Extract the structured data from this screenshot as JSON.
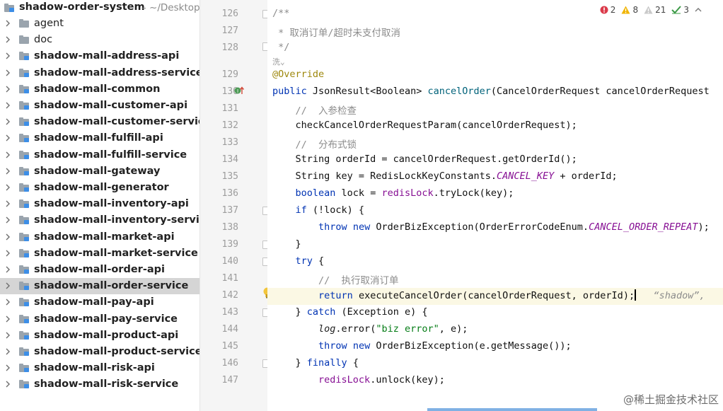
{
  "project": {
    "name": "shadow-order-system",
    "path": "~/Desktop",
    "items": [
      {
        "label": "agent",
        "type": "folder"
      },
      {
        "label": "doc",
        "type": "folder"
      },
      {
        "label": "shadow-mall-address-api",
        "type": "module"
      },
      {
        "label": "shadow-mall-address-service",
        "type": "module"
      },
      {
        "label": "shadow-mall-common",
        "type": "module"
      },
      {
        "label": "shadow-mall-customer-api",
        "type": "module"
      },
      {
        "label": "shadow-mall-customer-service",
        "type": "module"
      },
      {
        "label": "shadow-mall-fulfill-api",
        "type": "module"
      },
      {
        "label": "shadow-mall-fulfill-service",
        "type": "module"
      },
      {
        "label": "shadow-mall-gateway",
        "type": "module"
      },
      {
        "label": "shadow-mall-generator",
        "type": "module"
      },
      {
        "label": "shadow-mall-inventory-api",
        "type": "module"
      },
      {
        "label": "shadow-mall-inventory-service",
        "type": "module"
      },
      {
        "label": "shadow-mall-market-api",
        "type": "module"
      },
      {
        "label": "shadow-mall-market-service",
        "type": "module"
      },
      {
        "label": "shadow-mall-order-api",
        "type": "module"
      },
      {
        "label": "shadow-mall-order-service",
        "type": "module",
        "selected": true
      },
      {
        "label": "shadow-mall-pay-api",
        "type": "module"
      },
      {
        "label": "shadow-mall-pay-service",
        "type": "module"
      },
      {
        "label": "shadow-mall-product-api",
        "type": "module"
      },
      {
        "label": "shadow-mall-product-service",
        "type": "module"
      },
      {
        "label": "shadow-mall-risk-api",
        "type": "module"
      },
      {
        "label": "shadow-mall-risk-service",
        "type": "module"
      }
    ]
  },
  "inspections": {
    "errors": "2",
    "warnings": "8",
    "weak_warnings": "21",
    "typos": "3"
  },
  "editor": {
    "line_numbers": [
      "126",
      "127",
      "128",
      "",
      "129",
      "130",
      "131",
      "132",
      "133",
      "134",
      "135",
      "136",
      "137",
      "138",
      "139",
      "140",
      "141",
      "142",
      "143",
      "144",
      "145",
      "146",
      "147"
    ],
    "code": {
      "l126": "/**",
      "l127": " * 取消订单/超时未支付取消",
      "l128": " */",
      "author_hint": "洗⌄",
      "l129": "@Override",
      "l130_kw": "public",
      "l130_type": " JsonResult<Boolean> ",
      "l130_fn": "cancelOrder",
      "l130_rest": "(CancelOrderRequest cancelOrderRequest",
      "l131": "    //  入参检查",
      "l132": "    checkCancelOrderRequestParam(cancelOrderRequest);",
      "l133": "    //  分布式锁",
      "l134": "    String orderId = cancelOrderRequest.getOrderId();",
      "l135_a": "    String key = RedisLockKeyConstants.",
      "l135_const": "CANCEL_KEY",
      "l135_b": " + orderId;",
      "l136_kw": "boolean",
      "l136_a": " lock = ",
      "l136_fld": "redisLock",
      "l136_b": ".tryLock(key);",
      "l137_kw": "if",
      "l137_a": " (!lock) {",
      "l138_kw1": "throw",
      "l138_kw2": "new",
      "l138_a": " OrderBizException(OrderErrorCodeEnum.",
      "l138_const": "CANCEL_ORDER_REPEAT",
      "l138_b": ");",
      "l139": "    }",
      "l140_kw": "try",
      "l140_a": " {",
      "l141": "        //  执行取消订单",
      "l142_kw": "return",
      "l142_a": " executeCancelOrder(cancelOrderRequest, orderId);",
      "l142_inlay": "“shadow”, ",
      "l143_a": "    } ",
      "l143_kw": "catch",
      "l143_b": " (Exception e) {",
      "l144_log": "log",
      "l144_a": ".error(",
      "l144_str": "\"biz error\"",
      "l144_b": ", e);",
      "l145_kw1": "throw",
      "l145_kw2": "new",
      "l145_a": " OrderBizException(e.getMessage());",
      "l146_a": "    } ",
      "l146_kw": "finally",
      "l146_b": " {",
      "l147_fld": "redisLock",
      "l147_a": ".unlock(key);"
    }
  },
  "watermark": "@稀土掘金技术社区",
  "colors": {
    "keyword": "#0033b3",
    "annotation": "#9e880d",
    "comment": "#8c8c8c",
    "string": "#067d17",
    "constant": "#871094",
    "function_decl": "#00627a",
    "selected_row": "#d5d5d5",
    "current_line": "#fbf8e4"
  }
}
